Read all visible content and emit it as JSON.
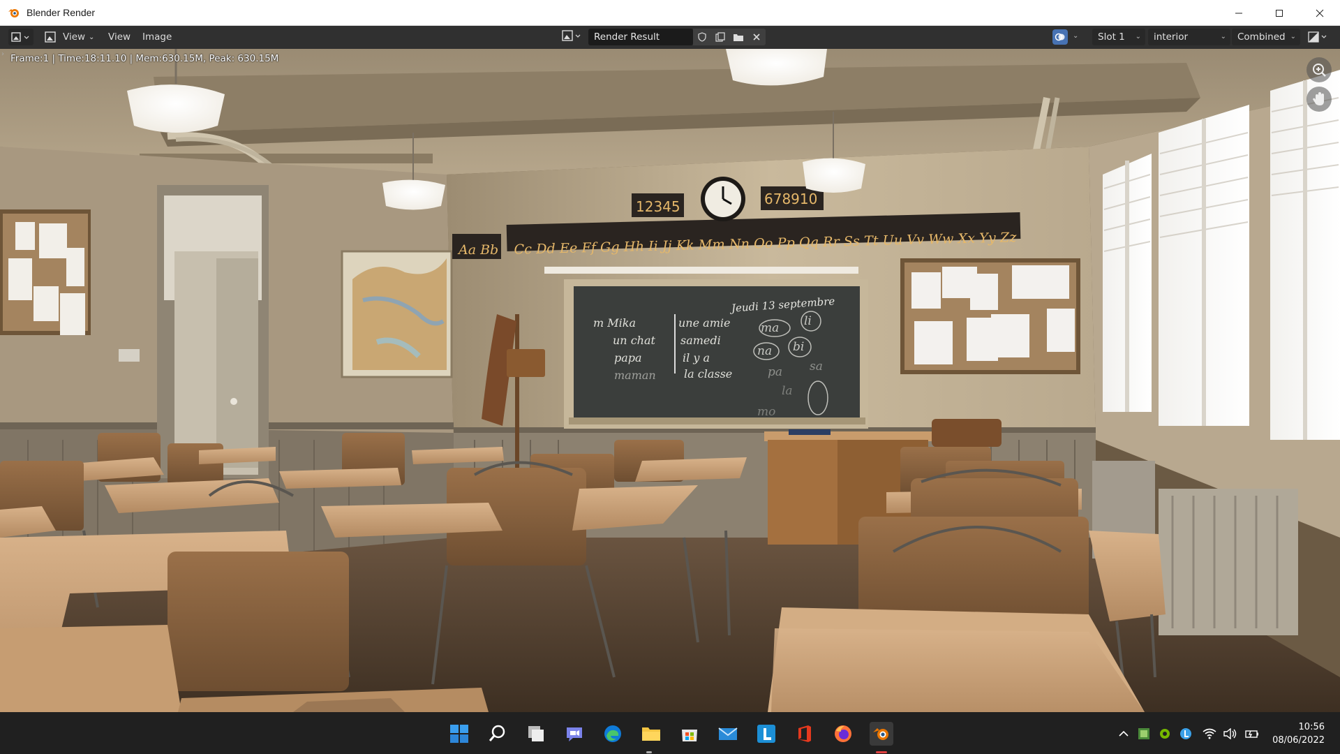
{
  "window": {
    "title": "Blender Render"
  },
  "header": {
    "menus": {
      "view_dropdown": "View",
      "view": "View",
      "image": "Image"
    },
    "image_name": "Render Result",
    "slot": "Slot 1",
    "view_layer": "interior",
    "pass": "Combined",
    "overlay_color": "#4772b3"
  },
  "viewport": {
    "render_info": "Frame:1 | Time:18:11.10 | Mem:630.15M, Peak: 630.15M",
    "scene": {
      "clock_numbers_left": "12345",
      "clock_numbers_right": "678910",
      "alphabet_left": "Aa Bb",
      "alphabet_main": "Cc Dd Ee Ff Gg Hh Ii Jj Kk Mm Nn Oo Pp Qq Rr Ss Tt Uu Vv Ww Xx Yy Zz",
      "chalk_date": "Jeudi 13 septembre",
      "chalk_left": [
        "m  Mika",
        "un chat",
        "papa",
        "maman"
      ],
      "chalk_mid": [
        "une amie",
        "samedi",
        "il y a",
        "la classe"
      ],
      "chalk_right": [
        "ma",
        "li",
        "na",
        "bi",
        "pa",
        "sa",
        "la",
        "mo"
      ]
    }
  },
  "taskbar": {
    "apps": [
      "start-icon",
      "search-icon",
      "task-view-icon",
      "teams-icon",
      "edge-icon",
      "file-explorer-icon",
      "store-icon",
      "mail-icon",
      "l-app-icon",
      "office-icon",
      "firefox-icon",
      "blender-icon"
    ],
    "time": "10:56",
    "date": "08/06/2022"
  }
}
